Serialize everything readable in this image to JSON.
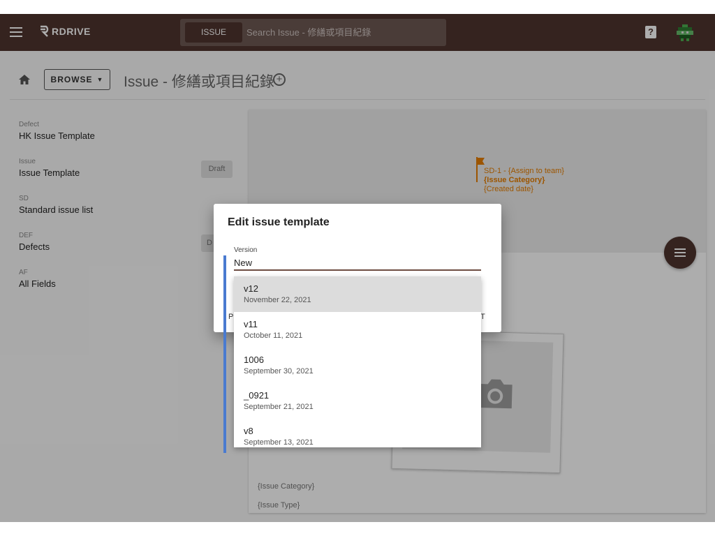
{
  "topbar": {
    "logo_text": "RDRIVE",
    "search_chip": "ISSUE",
    "search_placeholder": "Search Issue - 修繕或項目紀錄",
    "help_label": "?"
  },
  "header": {
    "browse_label": "BROWSE",
    "page_title": "Issue - 修繕或項目紀錄"
  },
  "sidebar": {
    "items": [
      {
        "key": "Defect",
        "value": "HK Issue Template"
      },
      {
        "key": "Issue",
        "value": "Issue Template"
      },
      {
        "key": "SD",
        "value": "Standard issue list"
      },
      {
        "key": "DEF",
        "value": "Defects"
      },
      {
        "key": "AF",
        "value": "All Fields"
      }
    ],
    "draft_chip": "Draft",
    "second_chip": "D"
  },
  "card": {
    "meta_line1": "SD-1 - {Assign to team}",
    "meta_line2": "{Issue Category}",
    "meta_line3": "{Created date}",
    "field1": "{Issue Category}",
    "field2": "{Issue Type}"
  },
  "dialog": {
    "title": "Edit issue template",
    "version_label": "Version",
    "version_value": "New",
    "stub_left": "P",
    "stub_right": "T"
  },
  "dropdown": {
    "options": [
      {
        "title": "v12",
        "date": "November 22, 2021",
        "selected": true
      },
      {
        "title": "v11",
        "date": "October 11, 2021",
        "selected": false
      },
      {
        "title": "1006",
        "date": "September 30, 2021",
        "selected": false
      },
      {
        "title": "_0921",
        "date": "September 21, 2021",
        "selected": false
      },
      {
        "title": "v8",
        "date": "September 13, 2021",
        "selected": false
      }
    ]
  },
  "colors": {
    "brand": "#4e342e",
    "accent_orange": "#e67e00",
    "scrollbar_blue": "#4a7bd0"
  }
}
